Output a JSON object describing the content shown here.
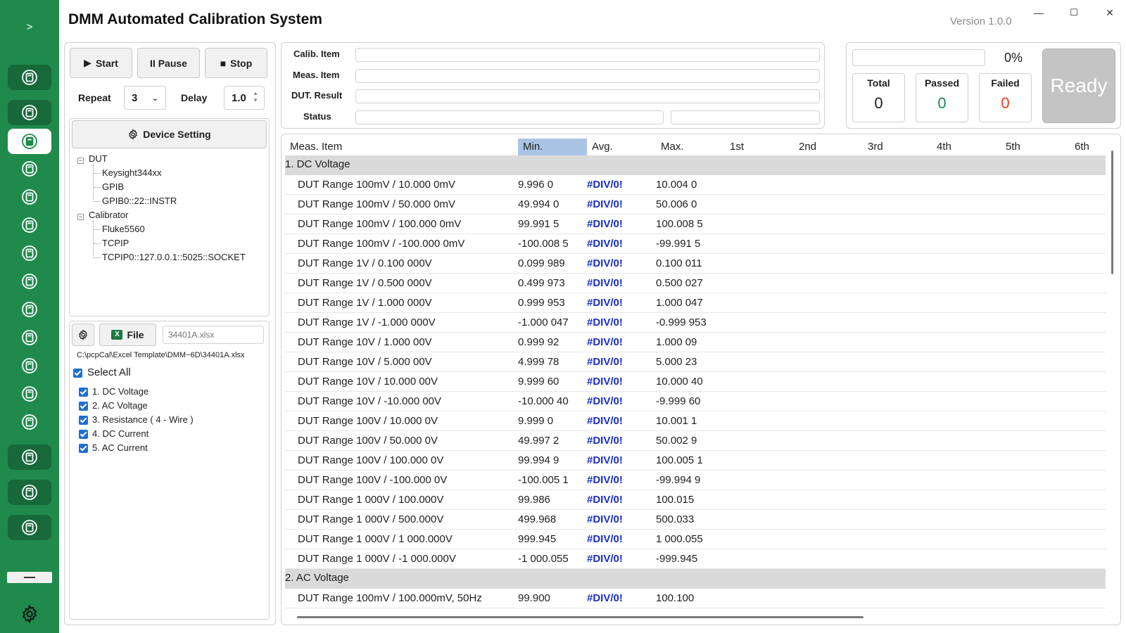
{
  "app": {
    "title": "DMM Automated Calibration System",
    "version": "Version 1.0.0",
    "window_controls": [
      "—",
      "☐",
      "✕"
    ]
  },
  "rail": {
    "expand_label": ">",
    "accent": "#1f8a4c"
  },
  "controls": {
    "start_label": "Start",
    "pause_label": "II Pause",
    "stop_label": "Stop",
    "repeat_label": "Repeat",
    "repeat_value": "3",
    "delay_label": "Delay",
    "delay_value": "1.0",
    "device_setting_label": "Device Setting"
  },
  "tree": {
    "dut_label": "DUT",
    "dut_items": [
      "Keysight344xx",
      "GPIB",
      "GPIB0::22::INSTR"
    ],
    "calibrator_label": "Calibrator",
    "calibrator_items": [
      "Fluke5560",
      "TCPIP",
      "TCPIP0::127.0.0.1::5025::SOCKET"
    ]
  },
  "file": {
    "file_button_label": "File",
    "file_name_placeholder": "34401A.xlsx",
    "path": "C:\\pcpCal\\Excel Template\\DMM~6D\\34401A.xlsx",
    "select_all_label": "Select All",
    "items": [
      "1. DC Voltage",
      "2. AC Voltage",
      "3. Resistance ( 4 - Wire )",
      "4. DC Current",
      "5. AC Current"
    ]
  },
  "info": {
    "calib_item_label": "Calib. Item",
    "meas_item_label": "Meas. Item",
    "dut_result_label": "DUT. Result",
    "status_label": "Status"
  },
  "progress": {
    "percent_text": "0%",
    "percent_value": 0,
    "total_label": "Total",
    "total_value": "0",
    "passed_label": "Passed",
    "passed_value": "0",
    "failed_label": "Failed",
    "failed_value": "0",
    "ready_label": "Ready",
    "passed_color": "#1f8a4c",
    "failed_color": "#e0401e"
  },
  "grid": {
    "columns": [
      "Meas. Item",
      "Min.",
      "Avg.",
      "Max.",
      "1st",
      "2nd",
      "3rd",
      "4th",
      "5th",
      "6th"
    ],
    "sorted_column": "Min.",
    "avg_color": "#1a2fbf",
    "rows": [
      {
        "type": "cat",
        "item": "1. DC Voltage"
      },
      {
        "item": "DUT Range 100mV / 10.000 0mV",
        "min": "9.996 0",
        "avg": "#DIV/0!",
        "max": "10.004 0"
      },
      {
        "item": "DUT Range 100mV / 50.000 0mV",
        "min": "49.994 0",
        "avg": "#DIV/0!",
        "max": "50.006 0"
      },
      {
        "item": "DUT Range 100mV / 100.000 0mV",
        "min": "99.991 5",
        "avg": "#DIV/0!",
        "max": "100.008 5"
      },
      {
        "item": "DUT Range 100mV / -100.000 0mV",
        "min": "-100.008 5",
        "avg": "#DIV/0!",
        "max": "-99.991 5"
      },
      {
        "item": "DUT Range 1V / 0.100 000V",
        "min": "0.099 989",
        "avg": "#DIV/0!",
        "max": "0.100 011"
      },
      {
        "item": "DUT Range 1V / 0.500 000V",
        "min": "0.499 973",
        "avg": "#DIV/0!",
        "max": "0.500 027"
      },
      {
        "item": "DUT Range 1V / 1.000 000V",
        "min": "0.999 953",
        "avg": "#DIV/0!",
        "max": "1.000 047"
      },
      {
        "item": "DUT Range 1V / -1.000 000V",
        "min": "-1.000 047",
        "avg": "#DIV/0!",
        "max": "-0.999 953"
      },
      {
        "item": "DUT Range 10V / 1.000 00V",
        "min": "0.999 92",
        "avg": "#DIV/0!",
        "max": "1.000 09"
      },
      {
        "item": "DUT Range 10V / 5.000 00V",
        "min": "4.999 78",
        "avg": "#DIV/0!",
        "max": "5.000 23"
      },
      {
        "item": "DUT Range 10V / 10.000 00V",
        "min": "9.999 60",
        "avg": "#DIV/0!",
        "max": "10.000 40"
      },
      {
        "item": "DUT Range 10V / -10.000 00V",
        "min": "-10.000 40",
        "avg": "#DIV/0!",
        "max": "-9.999 60"
      },
      {
        "item": "DUT Range 100V / 10.000 0V",
        "min": "9.999 0",
        "avg": "#DIV/0!",
        "max": "10.001 1"
      },
      {
        "item": "DUT Range 100V / 50.000 0V",
        "min": "49.997 2",
        "avg": "#DIV/0!",
        "max": "50.002 9"
      },
      {
        "item": "DUT Range 100V / 100.000 0V",
        "min": "99.994 9",
        "avg": "#DIV/0!",
        "max": "100.005 1"
      },
      {
        "item": "DUT Range 100V / -100.000 0V",
        "min": "-100.005 1",
        "avg": "#DIV/0!",
        "max": "-99.994 9"
      },
      {
        "item": "DUT Range 1 000V / 100.000V",
        "min": "99.986",
        "avg": "#DIV/0!",
        "max": "100.015"
      },
      {
        "item": "DUT Range 1 000V / 500.000V",
        "min": "499.968",
        "avg": "#DIV/0!",
        "max": "500.033"
      },
      {
        "item": "DUT Range 1 000V / 1 000.000V",
        "min": "999.945",
        "avg": "#DIV/0!",
        "max": "1 000.055"
      },
      {
        "item": "DUT Range 1 000V / -1 000.000V",
        "min": "-1 000.055",
        "avg": "#DIV/0!",
        "max": "-999.945"
      },
      {
        "type": "cat",
        "item": "2. AC Voltage"
      },
      {
        "item": "DUT Range 100mV / 100.000mV, 50Hz",
        "min": "99.900",
        "avg": "#DIV/0!",
        "max": "100.100"
      }
    ]
  }
}
